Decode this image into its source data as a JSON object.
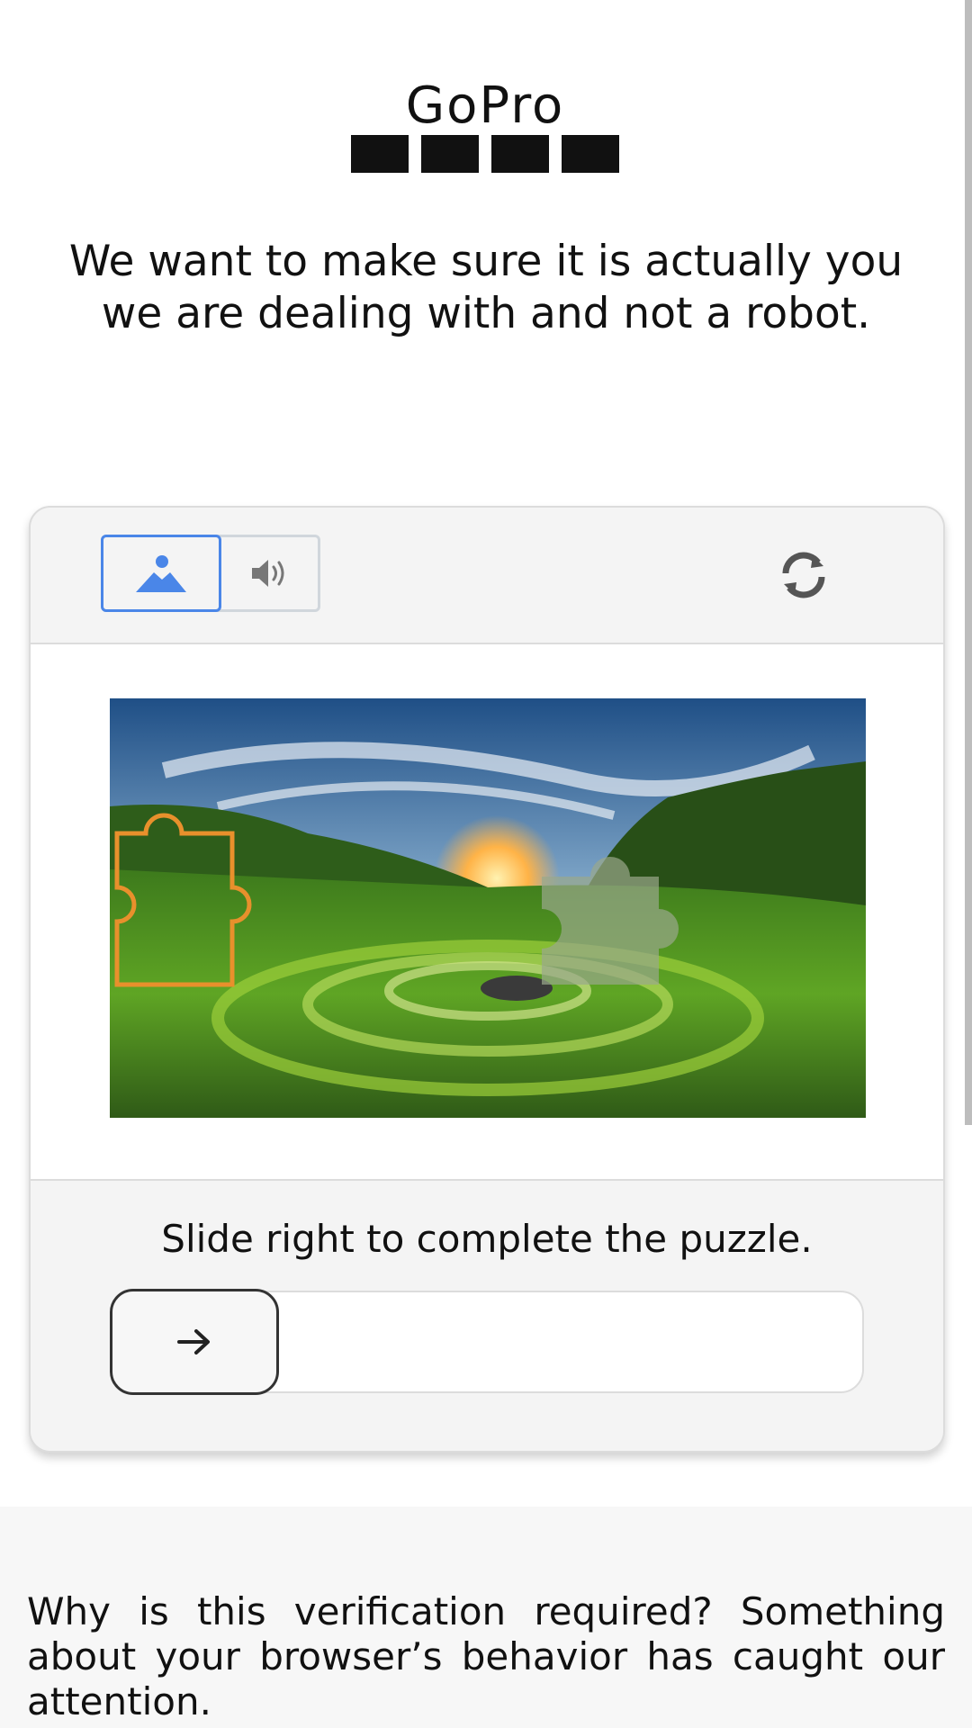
{
  "logo": {
    "brand": "GoPro"
  },
  "headline": "We want to make sure it is actually you we are dealing with and not a robot.",
  "captcha": {
    "mode_image_label": "image challenge",
    "mode_audio_label": "audio challenge",
    "refresh_label": "refresh challenge",
    "instruction": "Slide right to complete the puzzle.",
    "slider_progress": 0,
    "accent_color": "#4a86e8",
    "icons": {
      "image": "image-icon",
      "audio": "speaker-icon",
      "refresh": "refresh-icon",
      "slider": "arrow-right-icon"
    }
  },
  "explanation": "Why is this verification required? Something about your browser’s behavior has caught our attention."
}
